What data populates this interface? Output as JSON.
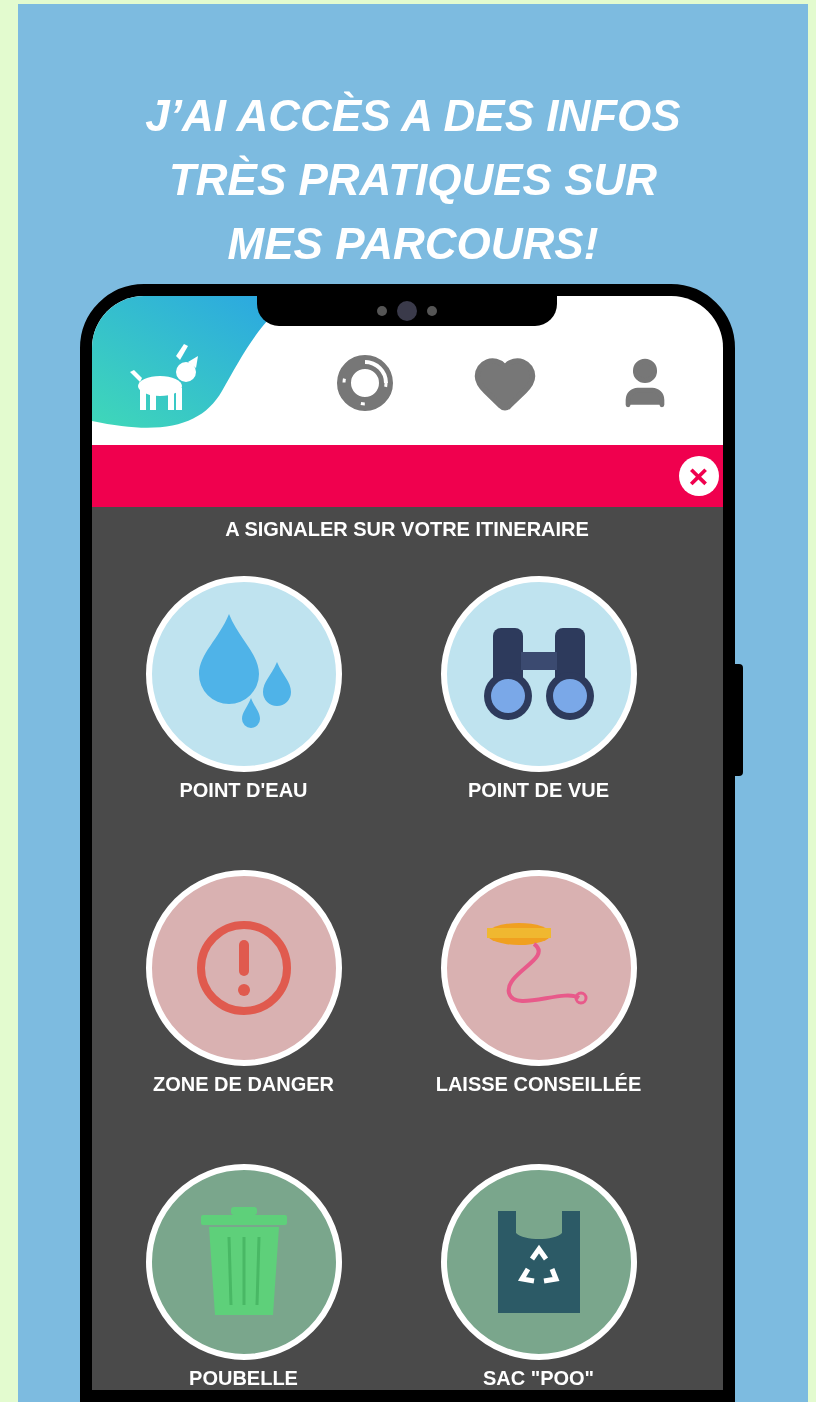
{
  "headline": [
    "J’AI ACCÈS A DES INFOS",
    "TRÈS PRATIQUES SUR",
    "MES PARCOURS!"
  ],
  "nav": [
    {
      "kind": "dog",
      "selected": true
    },
    {
      "kind": "donut",
      "selected": false
    },
    {
      "kind": "heart",
      "selected": false
    },
    {
      "kind": "user",
      "selected": false
    }
  ],
  "banner": {
    "close": "×"
  },
  "section_title": "A SIGNALER SUR VOTRE ITINERAIRE",
  "items": [
    {
      "kind": "water",
      "label": "POINT D'EAU",
      "color": "#bfe3ef"
    },
    {
      "kind": "binoculars",
      "label": "POINT DE VUE",
      "color": "#bfe3ef"
    },
    {
      "kind": "danger",
      "label": "ZONE DE DANGER",
      "color": "#d9b1b1"
    },
    {
      "kind": "leash",
      "label": "LAISSE CONSEILLÉE",
      "color": "#d9b1b1"
    },
    {
      "kind": "trash",
      "label": "POUBELLE",
      "color": "#7aa68c"
    },
    {
      "kind": "bag",
      "label": "SAC \"POO\"",
      "color": "#7aa68c"
    }
  ]
}
